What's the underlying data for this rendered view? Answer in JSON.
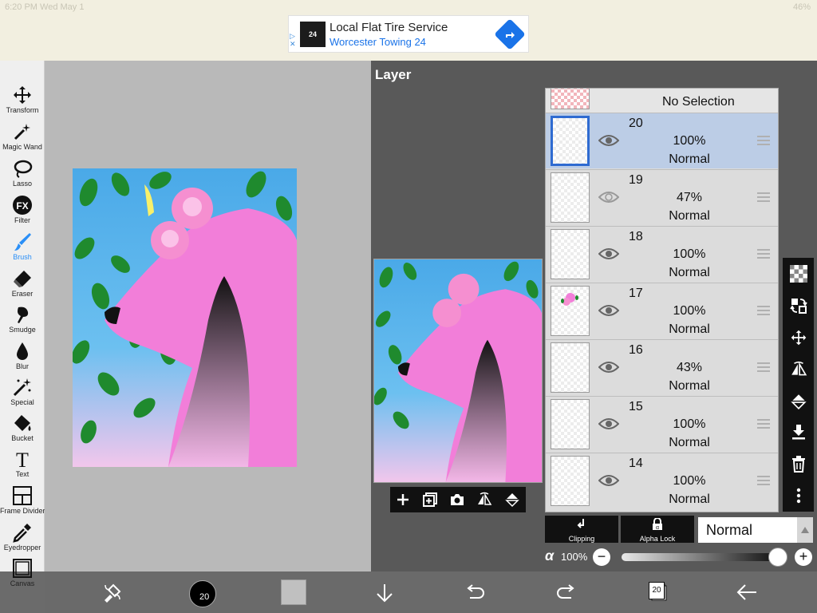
{
  "status": {
    "time": "6:20 PM  Wed May 1",
    "battery": "46%"
  },
  "ad": {
    "title": "Local Flat Tire Service",
    "subtitle": "Worcester Towing 24",
    "logo_text": "24",
    "directions_icon": "directions-icon"
  },
  "left_tools": [
    {
      "label": "Transform",
      "icon": "move-arrows-icon"
    },
    {
      "label": "Magic Wand",
      "icon": "magic-wand-icon"
    },
    {
      "label": "Lasso",
      "icon": "lasso-icon"
    },
    {
      "label": "Filter",
      "icon": "fx-icon"
    },
    {
      "label": "Brush",
      "icon": "brush-icon",
      "active": true
    },
    {
      "label": "Eraser",
      "icon": "eraser-icon"
    },
    {
      "label": "Smudge",
      "icon": "smudge-icon"
    },
    {
      "label": "Blur",
      "icon": "drop-icon"
    },
    {
      "label": "Special",
      "icon": "sparkle-wand-icon"
    },
    {
      "label": "Bucket",
      "icon": "bucket-icon"
    },
    {
      "label": "Text",
      "icon": "text-icon"
    },
    {
      "label": "Frame Divider",
      "icon": "frame-divider-icon"
    },
    {
      "label": "Eyedropper",
      "icon": "eyedropper-icon"
    },
    {
      "label": "Canvas",
      "icon": "canvas-icon"
    }
  ],
  "layer_panel": {
    "title": "Layer",
    "no_selection": "No Selection",
    "layers": [
      {
        "number": "20",
        "opacity": "100%",
        "blend": "Normal",
        "selected": true,
        "visible": true
      },
      {
        "number": "19",
        "opacity": "47%",
        "blend": "Normal",
        "selected": false,
        "visible": true
      },
      {
        "number": "18",
        "opacity": "100%",
        "blend": "Normal",
        "selected": false,
        "visible": true
      },
      {
        "number": "17",
        "opacity": "100%",
        "blend": "Normal",
        "selected": false,
        "visible": true
      },
      {
        "number": "16",
        "opacity": "43%",
        "blend": "Normal",
        "selected": false,
        "visible": true
      },
      {
        "number": "15",
        "opacity": "100%",
        "blend": "Normal",
        "selected": false,
        "visible": true
      },
      {
        "number": "14",
        "opacity": "100%",
        "blend": "Normal",
        "selected": false,
        "visible": true
      }
    ],
    "clipping_label": "Clipping",
    "alpha_lock_label": "Alpha Lock",
    "blend_mode": "Normal",
    "alpha_symbol": "α",
    "opacity": "100%",
    "opacity_value": 1.0,
    "minus": "−",
    "plus": "+"
  },
  "bottom_bar": {
    "brush_size": "20",
    "layer_count": "20"
  },
  "colors": {
    "accent": "#2a8ff7",
    "selected_row": "#bccde6",
    "panel": "#595959"
  }
}
